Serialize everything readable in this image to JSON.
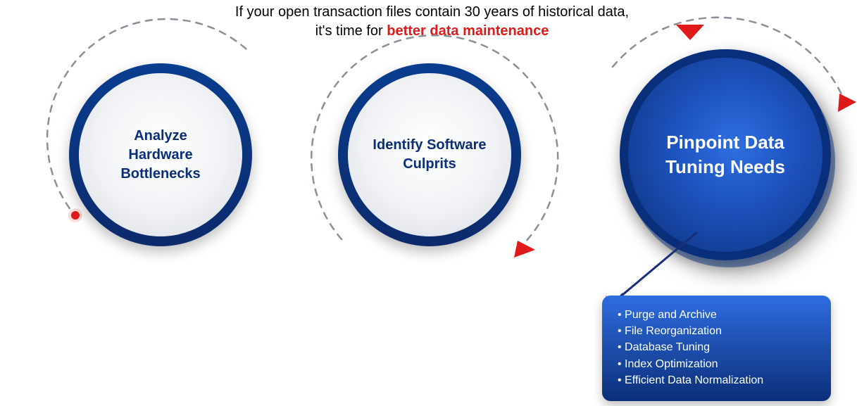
{
  "headline": {
    "line1": "If your open transaction files contain 30 years of historical data,",
    "line2_prefix": "it's time for ",
    "line2_emph": "better data maintenance"
  },
  "nodes": [
    {
      "label": "Analyze Hardware Bottlenecks"
    },
    {
      "label": "Identify Software Culprits"
    },
    {
      "label": "Pinpoint Data Tuning Needs"
    }
  ],
  "panel": {
    "items": [
      "Purge and Archive",
      "File Reorganization",
      "Database Tuning",
      "Index Optimization",
      "Efficient Data Normalization"
    ]
  },
  "colors": {
    "accent_blue_dark": "#0b2e78",
    "accent_blue_light": "#2e6de0",
    "danger_red": "#e01a1a",
    "dash_gray": "#8a8f99"
  }
}
